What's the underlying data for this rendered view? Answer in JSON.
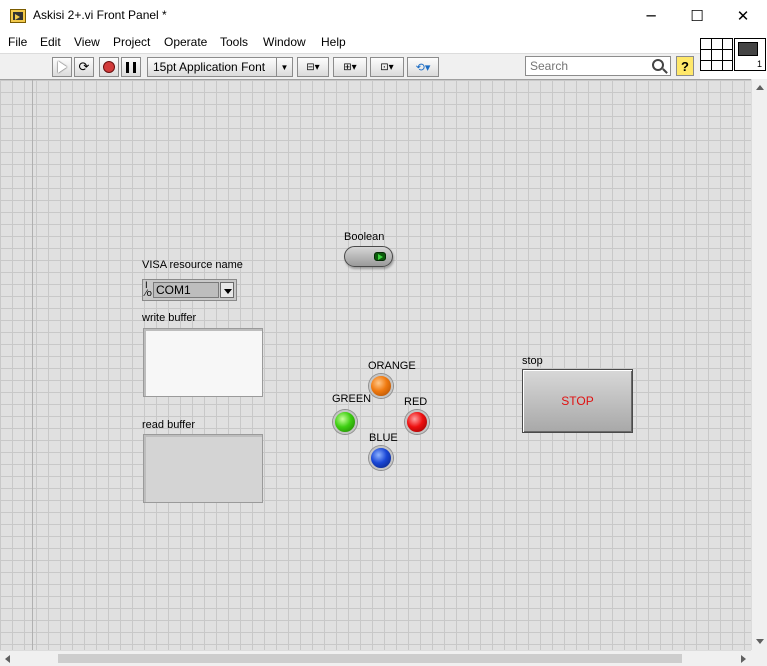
{
  "window": {
    "title": "Askisi 2+.vi Front Panel *",
    "minimize": "─",
    "maximize": "☐",
    "close": "✕"
  },
  "menu": [
    "File",
    "Edit",
    "View",
    "Project",
    "Operate",
    "Tools",
    "Window",
    "Help"
  ],
  "toolbar": {
    "font_label": "15pt Application Font",
    "search_placeholder": "Search",
    "help_label": "?"
  },
  "panel": {
    "boolean": {
      "label": "Boolean",
      "value": true
    },
    "visa": {
      "label": "VISA resource name",
      "value": "COM1",
      "icon": "I/O"
    },
    "write_buffer": {
      "label": "write buffer",
      "value": ""
    },
    "read_buffer": {
      "label": "read buffer",
      "value": ""
    },
    "leds": {
      "orange": {
        "label": "ORANGE",
        "color": "#f07a10"
      },
      "green": {
        "label": "GREEN",
        "color": "#3ecf12"
      },
      "red": {
        "label": "RED",
        "color": "#ee1010"
      },
      "blue": {
        "label": "BLUE",
        "color": "#1a47d6"
      }
    },
    "stop": {
      "label": "stop",
      "button_text": "STOP"
    }
  }
}
